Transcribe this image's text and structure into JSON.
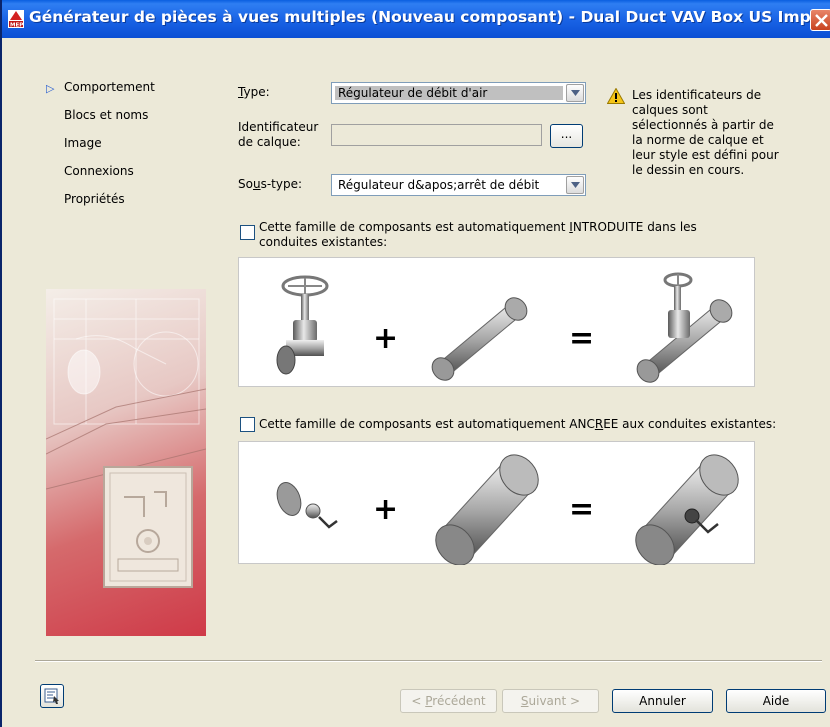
{
  "window": {
    "title": "Générateur de pièces à vues multiples (Nouveau composant) - Dual Duct VAV Box US Impe..."
  },
  "nav": {
    "items": [
      {
        "label": "Comportement",
        "active": true
      },
      {
        "label": "Blocs et noms"
      },
      {
        "label": "Image"
      },
      {
        "label": "Connexions"
      },
      {
        "label": "Propriétés"
      }
    ]
  },
  "form": {
    "type_label_pre": "",
    "type_label_u": "T",
    "type_label_post": "ype:",
    "type_value": "Régulateur de débit d'air",
    "layer_label_line1": "Identificateur",
    "layer_label_line2": "de calque:",
    "layer_value": "",
    "browse_label": "...",
    "subtype_label_pre": "So",
    "subtype_label_u": "u",
    "subtype_label_post": "s-type:",
    "subtype_value": "Régulateur d&apos;arrêt de débit"
  },
  "warning": {
    "icon": "warning-icon",
    "text": "Les identificateurs de\ncalques sont\nsélectionnés à partir de\nla norme de calque et\nleur style est défini pour\nle dessin en cours."
  },
  "options": {
    "inserted": {
      "checked": false,
      "label_pre": "Cette famille de composants est automatiquement ",
      "label_u": "I",
      "label_post": "NTRODUITE dans les",
      "label_line2": "conduites existantes:"
    },
    "anchored": {
      "checked": false,
      "label_pre": "Cette famille de composants est automatiquement ANC",
      "label_u": "R",
      "label_post": "EE aux conduites existantes:"
    }
  },
  "equations": {
    "plus": "+",
    "equals": "="
  },
  "buttons": {
    "prev_pre": "< ",
    "prev_u": "P",
    "prev_post": "récédent",
    "next_u": "S",
    "next_post": "uivant >",
    "cancel": "Annuler",
    "help": "Aide"
  },
  "colors": {
    "title_bar": "#1a64e6",
    "accent": "#2a5fd0",
    "dialog_bg": "#ece9d8"
  }
}
